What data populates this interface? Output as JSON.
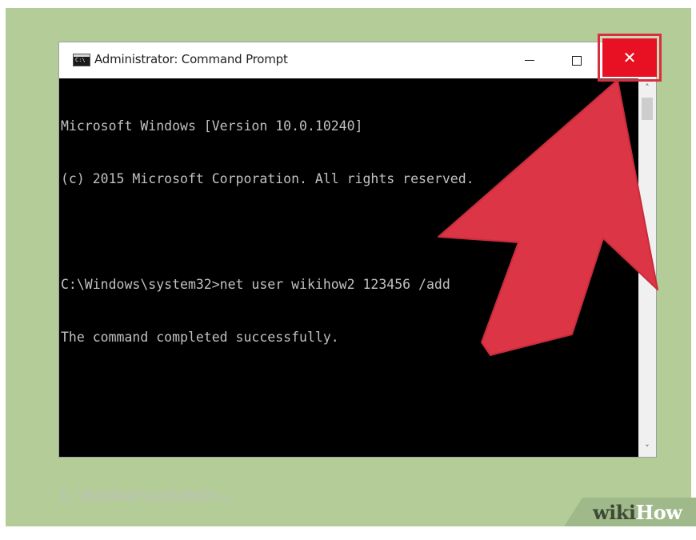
{
  "window": {
    "title": "Administrator: Command Prompt",
    "icon_text": "C:\\",
    "controls": {
      "minimize_icon": "minimize-icon",
      "maximize_icon": "maximize-icon",
      "close_label": "✕"
    }
  },
  "console": {
    "lines": [
      "Microsoft Windows [Version 10.0.10240]",
      "(c) 2015 Microsoft Corporation. All rights reserved.",
      "",
      "C:\\Windows\\system32>net user wikihow2 123456 /add",
      "The command completed successfully.",
      "",
      "",
      "C:\\Windows\\system32>"
    ],
    "text_color": "#c0c0c0",
    "background": "#000000"
  },
  "scrollbar": {
    "up_glyph": "˄",
    "down_glyph": "˅"
  },
  "annotation": {
    "arrow_color": "#dc3545",
    "highlight_color": "#d6303f"
  },
  "watermark": {
    "wiki": "wiki",
    "how": "How"
  },
  "colors": {
    "background": "#b3cc98",
    "close_button": "#e81123"
  }
}
